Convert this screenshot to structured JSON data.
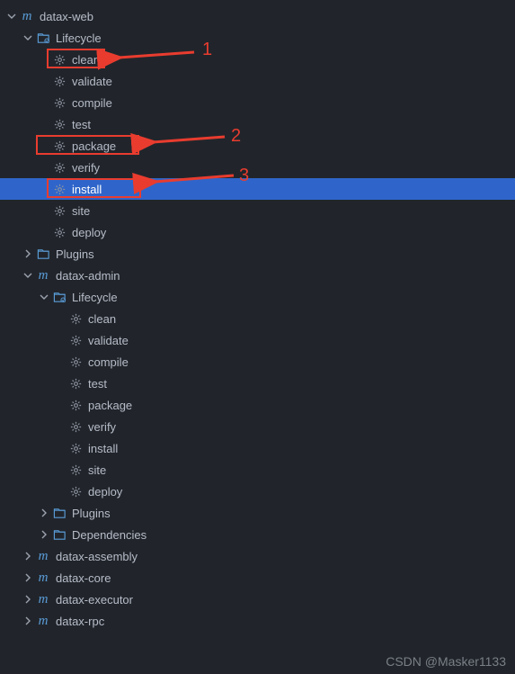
{
  "root": {
    "label": "datax-web"
  },
  "lifecycle_label": "Lifecycle",
  "goals": {
    "clean": "clean",
    "validate": "validate",
    "compile": "compile",
    "test": "test",
    "package": "package",
    "verify": "verify",
    "install": "install",
    "site": "site",
    "deploy": "deploy"
  },
  "plugins_label": "Plugins",
  "dependencies_label": "Dependencies",
  "modules": {
    "admin": "datax-admin",
    "assembly": "datax-assembly",
    "core": "datax-core",
    "executor": "datax-executor",
    "rpc": "datax-rpc"
  },
  "annotations": {
    "a1": "1",
    "a2": "2",
    "a3": "3"
  },
  "watermark": "CSDN @Masker1133"
}
